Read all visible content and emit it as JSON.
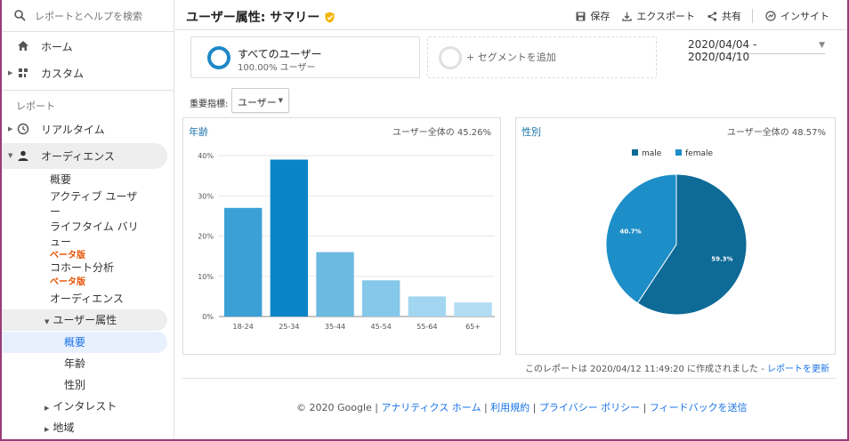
{
  "sidebar": {
    "search_label": "レポートとヘルプを検索",
    "home": "ホーム",
    "custom": "カスタム",
    "section_reports": "レポート",
    "realtime": "リアルタイム",
    "audience": "オーディエンス",
    "sub": {
      "overview": "概要",
      "active_users_1": "アクティブ ユーザ",
      "active_users_2": "ー",
      "lifetime_1": "ライフタイム バリ",
      "lifetime_2": "ュー",
      "lifetime_badge": "ベータ版",
      "cohort": "コホート分析",
      "cohort_badge": "ベータ版",
      "audiences": "オーディエンス",
      "demographics": "ユーザー属性",
      "demo_overview": "概要",
      "demo_age": "年齢",
      "demo_gender": "性別",
      "interests": "インタレスト",
      "geo": "地域"
    }
  },
  "header": {
    "title": "ユーザー属性: サマリー",
    "save": "保存",
    "export": "エクスポート",
    "share": "共有",
    "insights": "インサイト"
  },
  "segments": {
    "all_users": "すべてのユーザー",
    "all_users_pct": "100.00% ユーザー",
    "add_segment": "+ セグメントを追加"
  },
  "date_range": "2020/04/04 - 2020/04/10",
  "metric": {
    "label": "重要指標:",
    "selected": "ユーザー"
  },
  "age_panel": {
    "title": "年齢",
    "note": "ユーザー全体の 45.26%"
  },
  "gender_panel": {
    "title": "性別",
    "note": "ユーザー全体の 48.57%"
  },
  "report_note": {
    "text": "このレポートは 2020/04/12 11:49:20 に作成されました - ",
    "link": "レポートを更新"
  },
  "footer": {
    "copyright": "© 2020 Google",
    "links": [
      "アナリティクス ホーム",
      "利用規約",
      "プライバシー ポリシー",
      "フィードバックを送信"
    ]
  },
  "colors": {
    "accent": "#1a73a8",
    "link": "#1a73e8",
    "beta": "#e65100",
    "male": "#0e6a96",
    "female": "#1d8ec7"
  },
  "chart_data": [
    {
      "type": "bar",
      "title": "年齢",
      "categories": [
        "18-24",
        "25-34",
        "35-44",
        "45-54",
        "55-64",
        "65+"
      ],
      "values": [
        27,
        39,
        16,
        9,
        5,
        3.5
      ],
      "bar_colors": [
        "#3aa0d6",
        "#0a84c6",
        "#6cb9e1",
        "#85c8ea",
        "#a2d6f0",
        "#b1dcf2"
      ],
      "y_ticks": [
        "0%",
        "10%",
        "20%",
        "30%",
        "40%"
      ],
      "ylim": [
        0,
        40
      ],
      "grid": true
    },
    {
      "type": "pie",
      "title": "性別",
      "series": [
        {
          "name": "male",
          "value": 59.3,
          "label": "59.3%"
        },
        {
          "name": "female",
          "value": 40.7,
          "label": "40.7%"
        }
      ],
      "legend_position": "top"
    }
  ]
}
